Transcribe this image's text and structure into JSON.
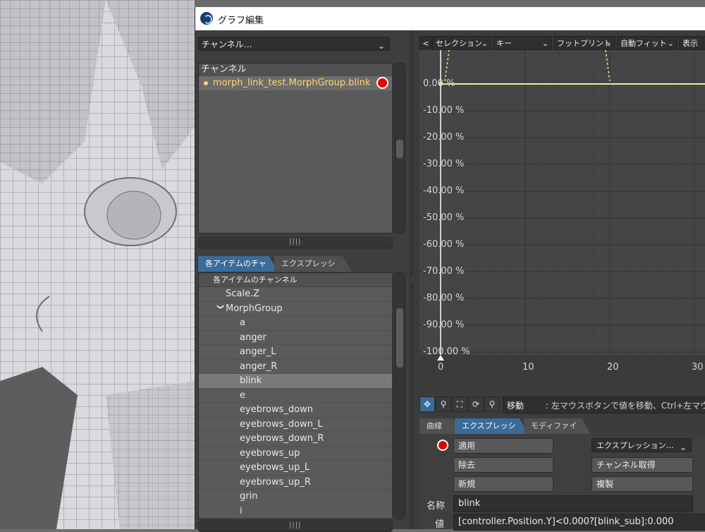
{
  "window": {
    "title": "グラフ編集"
  },
  "left": {
    "channel_dropdown": "チャンネル…",
    "channel_header": "チャンネル",
    "channel_row": "morph_link_test.MorphGroup.blink",
    "tabs": [
      "各アイテムのチャンネル",
      "エクスプレッション"
    ],
    "list_header": "各アイテムのチャンネル",
    "items": [
      {
        "label": "Scale.Z",
        "indent": 1
      },
      {
        "label": "MorphGroup",
        "indent": 1,
        "expanded": true
      },
      {
        "label": "a",
        "indent": 2
      },
      {
        "label": "anger",
        "indent": 2
      },
      {
        "label": "anger_L",
        "indent": 2
      },
      {
        "label": "anger_R",
        "indent": 2
      },
      {
        "label": "blink",
        "indent": 2,
        "selected": true
      },
      {
        "label": "e",
        "indent": 2
      },
      {
        "label": "eyebrows_down",
        "indent": 2
      },
      {
        "label": "eyebrows_down_L",
        "indent": 2
      },
      {
        "label": "eyebrows_down_R",
        "indent": 2
      },
      {
        "label": "eyebrows_up",
        "indent": 2
      },
      {
        "label": "eyebrows_up_L",
        "indent": 2
      },
      {
        "label": "eyebrows_up_R",
        "indent": 2
      },
      {
        "label": "grin",
        "indent": 2
      },
      {
        "label": "i",
        "indent": 2
      }
    ]
  },
  "graph": {
    "toolbar": {
      "back": "<",
      "selection": "セレクション",
      "key": "キー",
      "footprint": "フットプリント",
      "autofit": "自動フィット",
      "view": "表示"
    },
    "y_labels": [
      "0.00 %",
      "-10.00 %",
      "-20.00 %",
      "-30.00 %",
      "-40.00 %",
      "-50.00 %",
      "-60.00 %",
      "-70.00 %",
      "-80.00 %",
      "-90.00 %",
      "-100.00 %"
    ],
    "y_values": [
      0,
      -10,
      -20,
      -30,
      -40,
      -50,
      -60,
      -70,
      -80,
      -90,
      -100
    ],
    "x_labels": [
      "0",
      "10",
      "20",
      "30"
    ],
    "x_values": [
      0,
      10,
      20,
      30
    ],
    "curve_value": 0,
    "colors": {
      "curve": "#f4e3a0",
      "cursor": "#ffffff",
      "grid": "#3a3a3a",
      "selection": "#3b6b99"
    }
  },
  "mode_bar": {
    "icons": [
      "move-icon",
      "key-pin-icon",
      "fit-icon",
      "refresh-icon",
      "magnify-icon"
    ],
    "label": "移動",
    "hint": ": 左マウスボタンで値を移動、Ctrl+左マウス"
  },
  "bottom": {
    "tabs": [
      "曲線",
      "エクスプレッション",
      "モディファイヤ"
    ],
    "apply": "適用",
    "remove": "除去",
    "new": "新規",
    "expr_dropdown": "エクスプレッション…",
    "get_channel": "チャンネル取得",
    "duplicate": "複製",
    "name_label": "名称",
    "name_value": "blink",
    "value_label": "値",
    "value_value": "[controller.Position.Y]<0.000?[blink_sub]:0.000"
  }
}
